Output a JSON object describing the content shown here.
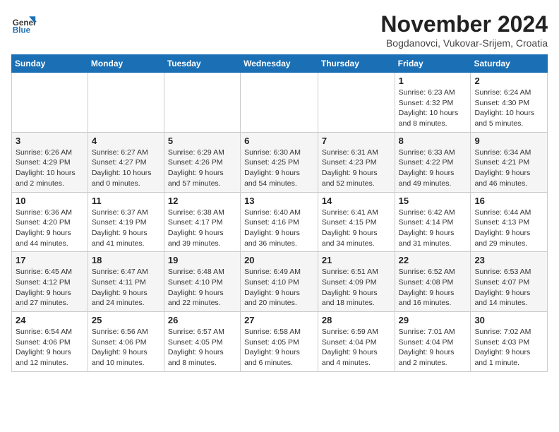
{
  "logo": {
    "general": "General",
    "blue": "Blue"
  },
  "header": {
    "month": "November 2024",
    "location": "Bogdanovci, Vukovar-Srijem, Croatia"
  },
  "weekdays": [
    "Sunday",
    "Monday",
    "Tuesday",
    "Wednesday",
    "Thursday",
    "Friday",
    "Saturday"
  ],
  "weeks": [
    [
      {
        "day": "",
        "info": ""
      },
      {
        "day": "",
        "info": ""
      },
      {
        "day": "",
        "info": ""
      },
      {
        "day": "",
        "info": ""
      },
      {
        "day": "",
        "info": ""
      },
      {
        "day": "1",
        "info": "Sunrise: 6:23 AM\nSunset: 4:32 PM\nDaylight: 10 hours and 8 minutes."
      },
      {
        "day": "2",
        "info": "Sunrise: 6:24 AM\nSunset: 4:30 PM\nDaylight: 10 hours and 5 minutes."
      }
    ],
    [
      {
        "day": "3",
        "info": "Sunrise: 6:26 AM\nSunset: 4:29 PM\nDaylight: 10 hours and 2 minutes."
      },
      {
        "day": "4",
        "info": "Sunrise: 6:27 AM\nSunset: 4:27 PM\nDaylight: 10 hours and 0 minutes."
      },
      {
        "day": "5",
        "info": "Sunrise: 6:29 AM\nSunset: 4:26 PM\nDaylight: 9 hours and 57 minutes."
      },
      {
        "day": "6",
        "info": "Sunrise: 6:30 AM\nSunset: 4:25 PM\nDaylight: 9 hours and 54 minutes."
      },
      {
        "day": "7",
        "info": "Sunrise: 6:31 AM\nSunset: 4:23 PM\nDaylight: 9 hours and 52 minutes."
      },
      {
        "day": "8",
        "info": "Sunrise: 6:33 AM\nSunset: 4:22 PM\nDaylight: 9 hours and 49 minutes."
      },
      {
        "day": "9",
        "info": "Sunrise: 6:34 AM\nSunset: 4:21 PM\nDaylight: 9 hours and 46 minutes."
      }
    ],
    [
      {
        "day": "10",
        "info": "Sunrise: 6:36 AM\nSunset: 4:20 PM\nDaylight: 9 hours and 44 minutes."
      },
      {
        "day": "11",
        "info": "Sunrise: 6:37 AM\nSunset: 4:19 PM\nDaylight: 9 hours and 41 minutes."
      },
      {
        "day": "12",
        "info": "Sunrise: 6:38 AM\nSunset: 4:17 PM\nDaylight: 9 hours and 39 minutes."
      },
      {
        "day": "13",
        "info": "Sunrise: 6:40 AM\nSunset: 4:16 PM\nDaylight: 9 hours and 36 minutes."
      },
      {
        "day": "14",
        "info": "Sunrise: 6:41 AM\nSunset: 4:15 PM\nDaylight: 9 hours and 34 minutes."
      },
      {
        "day": "15",
        "info": "Sunrise: 6:42 AM\nSunset: 4:14 PM\nDaylight: 9 hours and 31 minutes."
      },
      {
        "day": "16",
        "info": "Sunrise: 6:44 AM\nSunset: 4:13 PM\nDaylight: 9 hours and 29 minutes."
      }
    ],
    [
      {
        "day": "17",
        "info": "Sunrise: 6:45 AM\nSunset: 4:12 PM\nDaylight: 9 hours and 27 minutes."
      },
      {
        "day": "18",
        "info": "Sunrise: 6:47 AM\nSunset: 4:11 PM\nDaylight: 9 hours and 24 minutes."
      },
      {
        "day": "19",
        "info": "Sunrise: 6:48 AM\nSunset: 4:10 PM\nDaylight: 9 hours and 22 minutes."
      },
      {
        "day": "20",
        "info": "Sunrise: 6:49 AM\nSunset: 4:10 PM\nDaylight: 9 hours and 20 minutes."
      },
      {
        "day": "21",
        "info": "Sunrise: 6:51 AM\nSunset: 4:09 PM\nDaylight: 9 hours and 18 minutes."
      },
      {
        "day": "22",
        "info": "Sunrise: 6:52 AM\nSunset: 4:08 PM\nDaylight: 9 hours and 16 minutes."
      },
      {
        "day": "23",
        "info": "Sunrise: 6:53 AM\nSunset: 4:07 PM\nDaylight: 9 hours and 14 minutes."
      }
    ],
    [
      {
        "day": "24",
        "info": "Sunrise: 6:54 AM\nSunset: 4:06 PM\nDaylight: 9 hours and 12 minutes."
      },
      {
        "day": "25",
        "info": "Sunrise: 6:56 AM\nSunset: 4:06 PM\nDaylight: 9 hours and 10 minutes."
      },
      {
        "day": "26",
        "info": "Sunrise: 6:57 AM\nSunset: 4:05 PM\nDaylight: 9 hours and 8 minutes."
      },
      {
        "day": "27",
        "info": "Sunrise: 6:58 AM\nSunset: 4:05 PM\nDaylight: 9 hours and 6 minutes."
      },
      {
        "day": "28",
        "info": "Sunrise: 6:59 AM\nSunset: 4:04 PM\nDaylight: 9 hours and 4 minutes."
      },
      {
        "day": "29",
        "info": "Sunrise: 7:01 AM\nSunset: 4:04 PM\nDaylight: 9 hours and 2 minutes."
      },
      {
        "day": "30",
        "info": "Sunrise: 7:02 AM\nSunset: 4:03 PM\nDaylight: 9 hours and 1 minute."
      }
    ]
  ]
}
